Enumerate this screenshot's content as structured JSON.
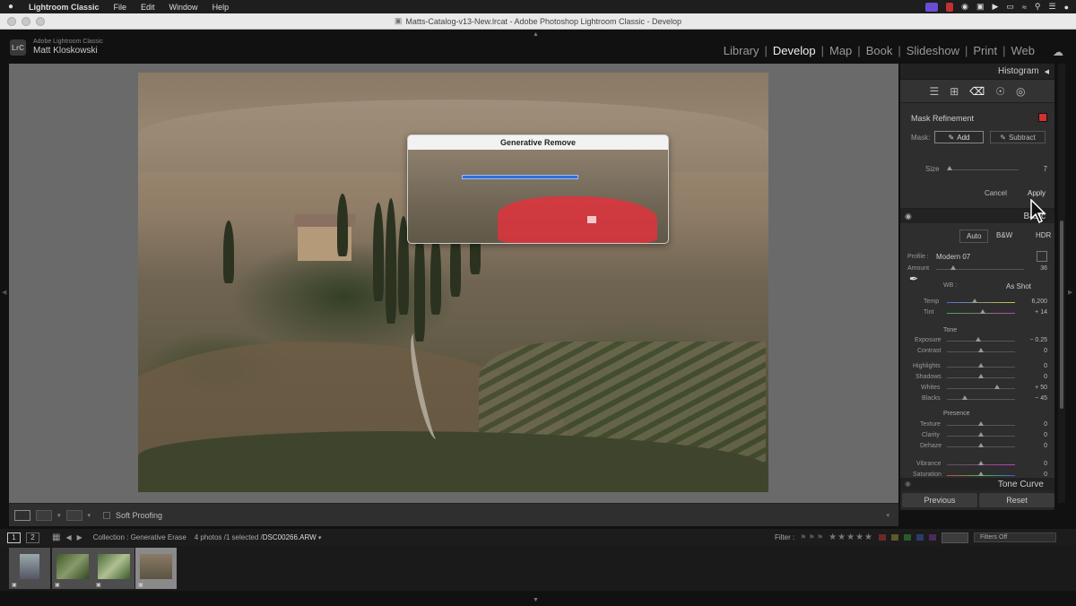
{
  "os_menu": {
    "app_name": "Lightroom Classic",
    "items": [
      "File",
      "Edit",
      "Window",
      "Help"
    ]
  },
  "window": {
    "title": "Matts-Catalog-v13-New.lrcat - Adobe Photoshop Lightroom Classic - Develop"
  },
  "identity": {
    "logo": "LrC",
    "product": "Adobe Lightroom Classic",
    "user": "Matt Kloskowski"
  },
  "modules": {
    "items": [
      "Library",
      "Develop",
      "Map",
      "Book",
      "Slideshow",
      "Print",
      "Web"
    ],
    "active": "Develop"
  },
  "dialog": {
    "title": "Generative Remove"
  },
  "right_panel": {
    "histogram_label": "Histogram",
    "mask_refinement": {
      "title": "Mask Refinement",
      "mask_label": "Mask:",
      "add_label": "Add",
      "subtract_label": "Subtract",
      "size_label": "Size",
      "size_value": "7",
      "size_fraction": 0.0,
      "cancel_label": "Cancel",
      "apply_label": "Apply",
      "swatch_color": "#d23030"
    },
    "basic": {
      "header": "Basic",
      "treatment": {
        "auto": "Auto",
        "bw": "B&W",
        "hdr": "HDR"
      },
      "profile_label": "Profile :",
      "profile_value": "Modern 07",
      "amount_label": "Amount",
      "amount_value": "36",
      "wb_label": "WB :",
      "wb_value": "As Shot",
      "temp_label": "Temp",
      "temp_value": "6,200",
      "tint_label": "Tint",
      "tint_value": "+ 14",
      "tone_title": "Tone",
      "exposure_label": "Exposure",
      "exposure_value": "− 0.25",
      "contrast_label": "Contrast",
      "contrast_value": "0",
      "highlights_label": "Highlights",
      "highlights_value": "0",
      "shadows_label": "Shadows",
      "shadows_value": "0",
      "whites_label": "Whites",
      "whites_value": "+ 50",
      "blacks_label": "Blacks",
      "blacks_value": "− 45",
      "presence_title": "Presence",
      "texture_label": "Texture",
      "texture_value": "0",
      "clarity_label": "Clarity",
      "clarity_value": "0",
      "dehaze_label": "Dehaze",
      "dehaze_value": "0",
      "vibrance_label": "Vibrance",
      "vibrance_value": "0",
      "saturation_label": "Saturation",
      "saturation_value": "0"
    },
    "tone_curve_label": "Tone Curve",
    "previous_label": "Previous",
    "reset_label": "Reset"
  },
  "toolbar": {
    "soft_proofing_label": "Soft Proofing"
  },
  "filmstrip_bar": {
    "page1": "1",
    "page2": "2",
    "collection": "Collection : Generative Erase",
    "count": "4 photos /1 selected /",
    "filename": "DSC00266.ARW",
    "filter_label": "Filter :",
    "stars": "★★★★★",
    "filters_off": "Filters Off"
  },
  "colors": {
    "accent_progress": "#2f6fe0",
    "mask_overlay": "#e1323c"
  }
}
